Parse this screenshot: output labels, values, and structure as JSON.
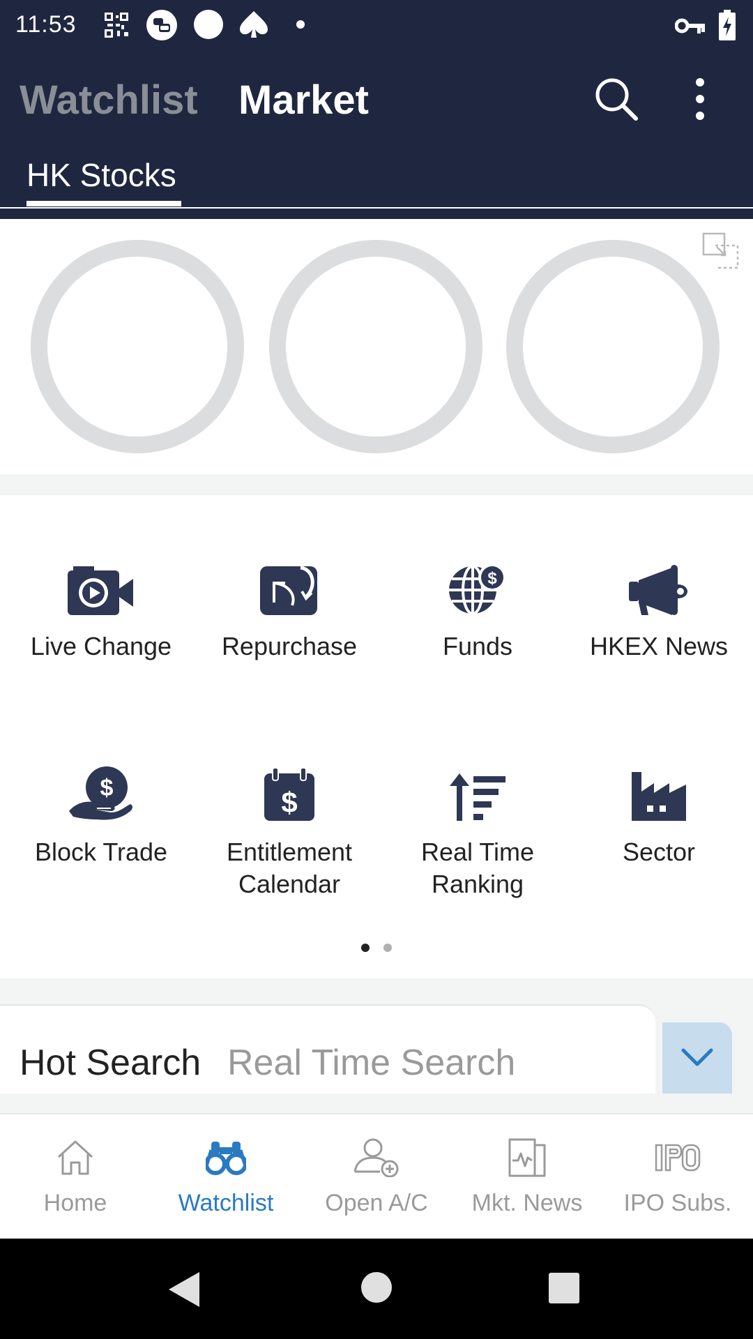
{
  "status_bar": {
    "time": "11:53",
    "icons": [
      "qr-icon",
      "chat-icon",
      "circle-icon",
      "spade-icon",
      "dot-icon",
      "vpn-key-icon",
      "battery-charging-icon"
    ]
  },
  "header": {
    "tabs": [
      {
        "label": "Watchlist",
        "active": false
      },
      {
        "label": "Market",
        "active": true
      }
    ],
    "subtab": "HK Stocks",
    "icons": [
      "search-icon",
      "more-vert-icon"
    ]
  },
  "features": [
    {
      "label": "Live Change",
      "icon": "video-play-icon"
    },
    {
      "label": "Repurchase",
      "icon": "repurchase-icon"
    },
    {
      "label": "Funds",
      "icon": "globe-dollar-icon"
    },
    {
      "label": "HKEX News",
      "icon": "megaphone-icon"
    },
    {
      "label": "Block Trade",
      "icon": "hand-dollar-icon"
    },
    {
      "label": "Entitlement\nCalendar",
      "icon": "calendar-dollar-icon"
    },
    {
      "label": "Real Time\nRanking",
      "icon": "ranking-arrow-icon"
    },
    {
      "label": "Sector",
      "icon": "factory-icon"
    }
  ],
  "pager": {
    "pages": 2,
    "current": 1
  },
  "hot_search": {
    "title": "Hot Search",
    "tab": "Real Time Search"
  },
  "bottom_nav": [
    {
      "label": "Home",
      "icon": "home-icon",
      "active": false
    },
    {
      "label": "Watchlist",
      "icon": "binoculars-icon",
      "active": true
    },
    {
      "label": "Open A/C",
      "icon": "add-user-icon",
      "active": false
    },
    {
      "label": "Mkt. News",
      "icon": "news-icon",
      "active": false
    },
    {
      "label": "IPO Subs.",
      "icon": "ipo-icon",
      "active": false
    }
  ],
  "colors": {
    "header_bg": "#1f2740",
    "icon": "#2e3754",
    "accent": "#2a7ac2",
    "ring": "#dcddde"
  }
}
